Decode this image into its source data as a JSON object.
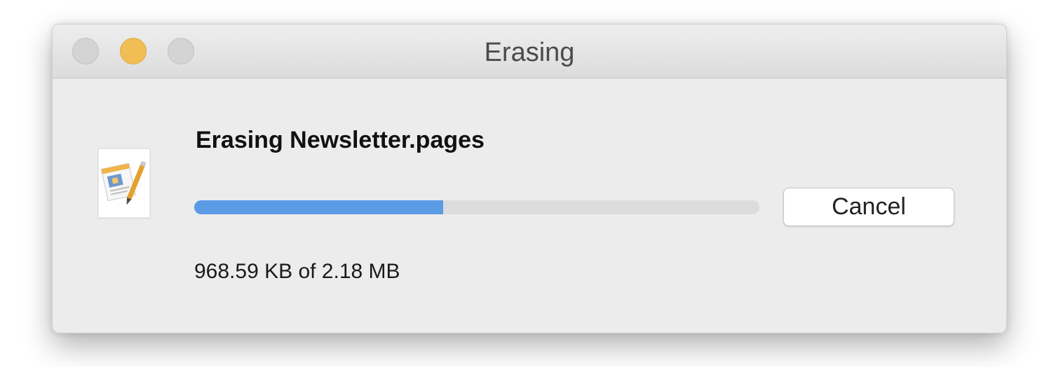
{
  "window": {
    "title": "Erasing"
  },
  "file": {
    "icon": "pages-document-icon"
  },
  "operation": {
    "heading": "Erasing Newsletter.pages",
    "progress_percent": 44,
    "status_text": "968.59 KB of 2.18 MB"
  },
  "buttons": {
    "cancel_label": "Cancel"
  },
  "colors": {
    "progress_fill": "#5b9be6",
    "minimize_light": "#f1bd55"
  }
}
